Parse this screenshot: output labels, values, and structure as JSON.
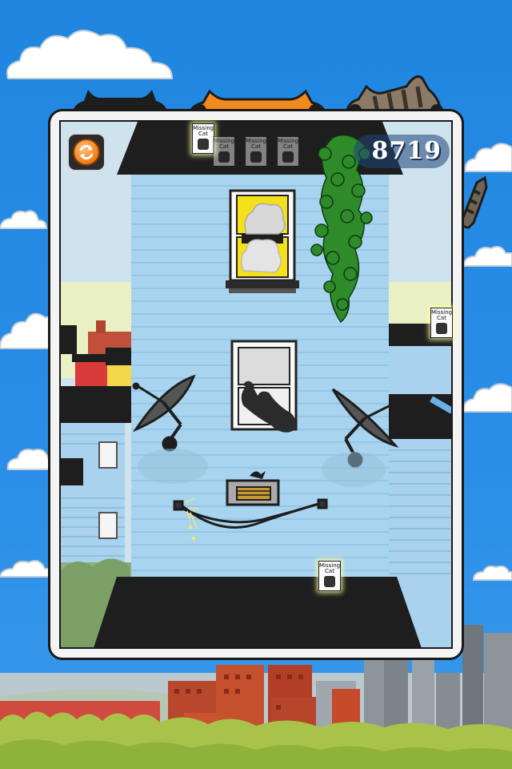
{
  "hud": {
    "score": "8719",
    "refresh_button": "refresh-icon"
  },
  "posters": {
    "label": "Missing Cat",
    "top_collected": "Missing Cat",
    "top_slot_1": "Missing Cat",
    "top_slot_2": "Missing Cat",
    "top_slot_3": "Missing Cat",
    "right_building": "Missing Cat",
    "bottom": "Missing Cat"
  },
  "colors": {
    "sky": "#1f86e0",
    "siding": "#a9d4ef",
    "roof": "#1e1e1e",
    "window_lit": "#f5e11a",
    "refresh_orange": "#f07c14",
    "score_text": "#ffffff"
  }
}
